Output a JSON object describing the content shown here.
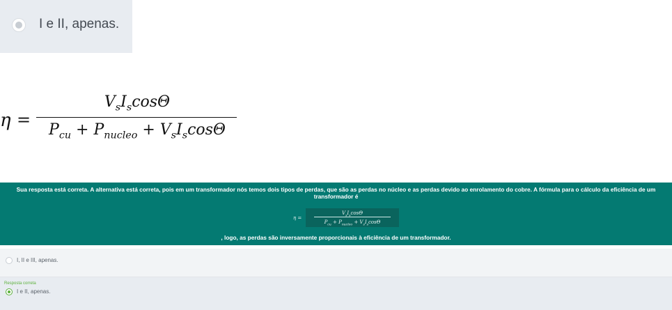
{
  "top_option": {
    "label": "I e II, apenas."
  },
  "formula": {
    "lhs": "η",
    "equals": "=",
    "numerator": "VₛIₛcosΘ",
    "denominator": "P꜀ᵤ + Pₙᵤ꜀ₗₑₒ + VₛIₛcosΘ"
  },
  "feedback": {
    "line1": "Sua resposta está correta. A alternativa está correta, pois em um transformador nós temos dois tipos de perdas, que são as perdas no núcleo e as perdas devido ao enrolamento do cobre. A fórmula para o cálculo da eficiência de um transformador é",
    "mini_lhs": "η =",
    "mini_numerator": "VₛIₛcosΘ",
    "mini_denominator": "P꜀ᵤ + Pₙᵤ꜀ₗₑₒ + VₛIₛcosΘ",
    "line3": ", logo, as perdas são inversamente proporcionais à eficiência de um transformador.",
    "background": "#047a72"
  },
  "options": [
    {
      "label": "I, II e III, apenas."
    }
  ],
  "correct": {
    "caption": "Resposta correta",
    "label": "I e II, apenas.",
    "accent": "#5bb03a"
  }
}
